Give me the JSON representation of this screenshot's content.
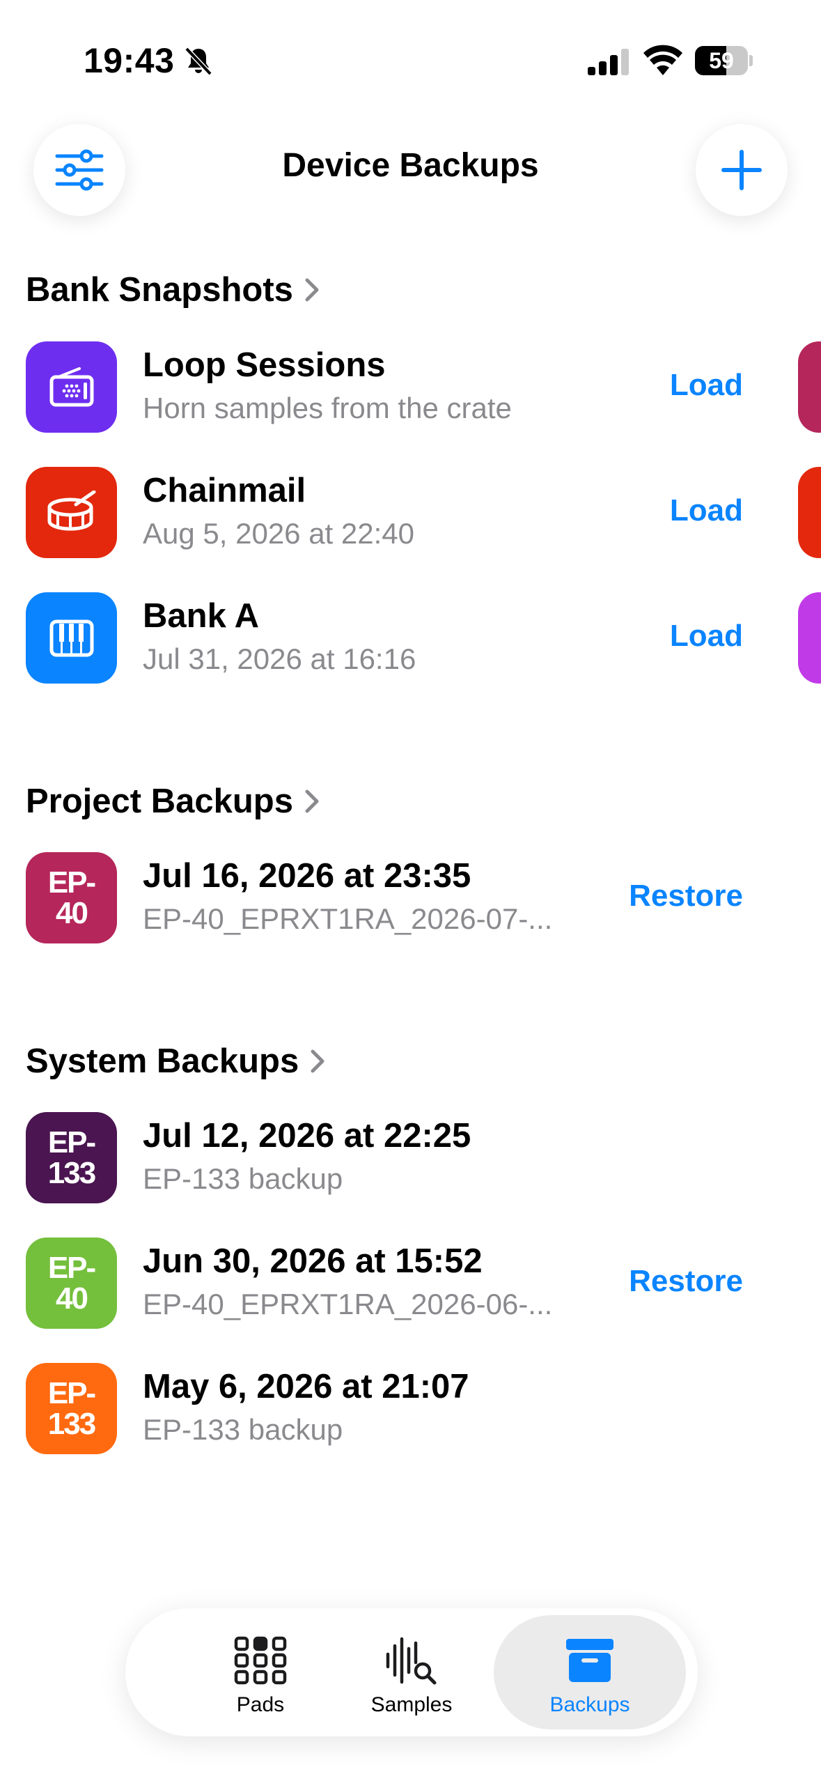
{
  "status": {
    "time": "19:43",
    "battery": "59",
    "battery_level": 0.59
  },
  "nav": {
    "title": "Device Backups"
  },
  "sections": {
    "bank": {
      "title": "Bank Snapshots",
      "items": [
        {
          "title": "Loop Sessions",
          "subtitle": "Horn samples from the crate",
          "action": "Load",
          "icon": "radio-icon",
          "color": "#6e2ef0"
        },
        {
          "title": "Chainmail",
          "subtitle": "Aug 5, 2026 at 22:40",
          "action": "Load",
          "icon": "drum-icon",
          "color": "#e3280d"
        },
        {
          "title": "Bank A",
          "subtitle": "Jul 31, 2026 at 16:16",
          "action": "Load",
          "icon": "piano-icon",
          "color": "#0a84ff"
        }
      ],
      "peek_colors": [
        "#b5265a",
        "#e3280d",
        "#c13ae8"
      ]
    },
    "project": {
      "title": "Project Backups",
      "items": [
        {
          "title": "Jul 16, 2026 at 23:35",
          "subtitle": "EP-40_EPRXT1RA_2026-07-...",
          "action": "Restore",
          "badge_top": "EP-",
          "badge_bottom": "40",
          "color": "#b5265a"
        }
      ]
    },
    "system": {
      "title": "System Backups",
      "items": [
        {
          "title": "Jul 12, 2026 at 22:25",
          "subtitle": "EP-133 backup",
          "action": "",
          "badge_top": "EP-",
          "badge_bottom": "133",
          "color": "#4a1550"
        },
        {
          "title": "Jun 30, 2026 at 15:52",
          "subtitle": "EP-40_EPRXT1RA_2026-06-...",
          "action": "Restore",
          "badge_top": "EP-",
          "badge_bottom": "40",
          "color": "#74bf3c"
        },
        {
          "title": "May 6, 2026 at 21:07",
          "subtitle": "EP-133 backup",
          "action": "",
          "badge_top": "EP-",
          "badge_bottom": "133",
          "color": "#ff6a10"
        }
      ]
    }
  },
  "tabs": [
    {
      "label": "Pads",
      "icon": "grid-icon"
    },
    {
      "label": "Samples",
      "icon": "waveform-search-icon"
    },
    {
      "label": "Backups",
      "icon": "archive-box-icon",
      "active": true
    }
  ],
  "colors": {
    "accent": "#0a84ff",
    "secondary_text": "#8a8a8e"
  }
}
